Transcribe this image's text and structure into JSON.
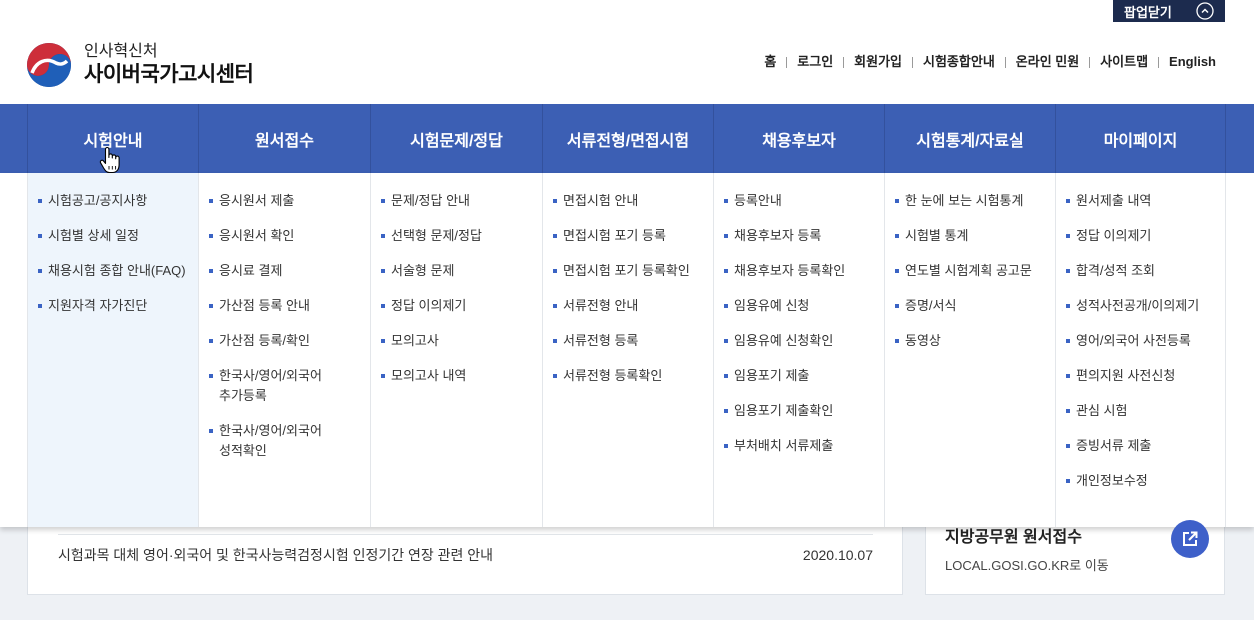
{
  "popup": {
    "close_label": "팝업닫기",
    "icon": "chevron-up-icon"
  },
  "header": {
    "org_name": "인사혁신처",
    "site_name": "사이버국가고시센터",
    "logo_icon": "government-emblem-icon"
  },
  "utility_nav": [
    {
      "label": "홈"
    },
    {
      "label": "로그인"
    },
    {
      "label": "회원가입"
    },
    {
      "label": "시험종합안내"
    },
    {
      "label": "온라인 민원"
    },
    {
      "label": "사이트맵"
    },
    {
      "label": "English"
    }
  ],
  "main_nav": [
    {
      "label": "시험안내",
      "active": true,
      "items": [
        "시험공고/공지사항",
        "시험별 상세 일정",
        "채용시험 종합 안내(FAQ)",
        "지원자격 자가진단"
      ]
    },
    {
      "label": "원서접수",
      "items": [
        "응시원서 제출",
        "응시원서 확인",
        "응시료 결제",
        "가산점 등록 안내",
        "가산점 등록/확인",
        "한국사/영어/외국어\n추가등록",
        "한국사/영어/외국어\n성적확인"
      ]
    },
    {
      "label": "시험문제/정답",
      "items": [
        "문제/정답 안내",
        "선택형 문제/정답",
        "서술형 문제",
        "정답 이의제기",
        "모의고사",
        "모의고사 내역"
      ]
    },
    {
      "label": "서류전형/면접시험",
      "items": [
        "면접시험 안내",
        "면접시험 포기 등록",
        "면접시험 포기 등록확인",
        "서류전형 안내",
        "서류전형 등록",
        "서류전형 등록확인"
      ]
    },
    {
      "label": "채용후보자",
      "items": [
        "등록안내",
        "채용후보자 등록",
        "채용후보자 등록확인",
        "임용유예 신청",
        "임용유예 신청확인",
        "임용포기 제출",
        "임용포기 제출확인",
        "부처배치 서류제출"
      ]
    },
    {
      "label": "시험통계/자료실",
      "items": [
        "한 눈에 보는 시험통계",
        "시험별 통계",
        "연도별 시험계획 공고문",
        "증명/서식",
        "동영상"
      ]
    },
    {
      "label": "마이페이지",
      "items": [
        "원서제출 내역",
        "정답 이의제기",
        "합격/성적 조회",
        "성적사전공개/이의제기",
        "영어/외국어 사전등록",
        "편의지원 사전신청",
        "관심 시험",
        "증빙서류 제출",
        "개인정보수정"
      ]
    }
  ],
  "notice": {
    "title": "시험과목 대체 영어·외국어 및 한국사능력검정시험 인정기간 연장 관련 안내",
    "date": "2020.10.07"
  },
  "quick_link": {
    "title": "지방공무원 원서접수",
    "description": "LOCAL.GOSI.GO.KR로 이동",
    "icon": "external-link-icon"
  },
  "colors": {
    "nav_bg": "#3c5fb4",
    "popup_bg": "#1c2b4e",
    "bullet": "#3a63c4",
    "active_column_bg": "#eef5fc",
    "link_button": "#3e60c9",
    "page_bg": "#eef1f5"
  }
}
